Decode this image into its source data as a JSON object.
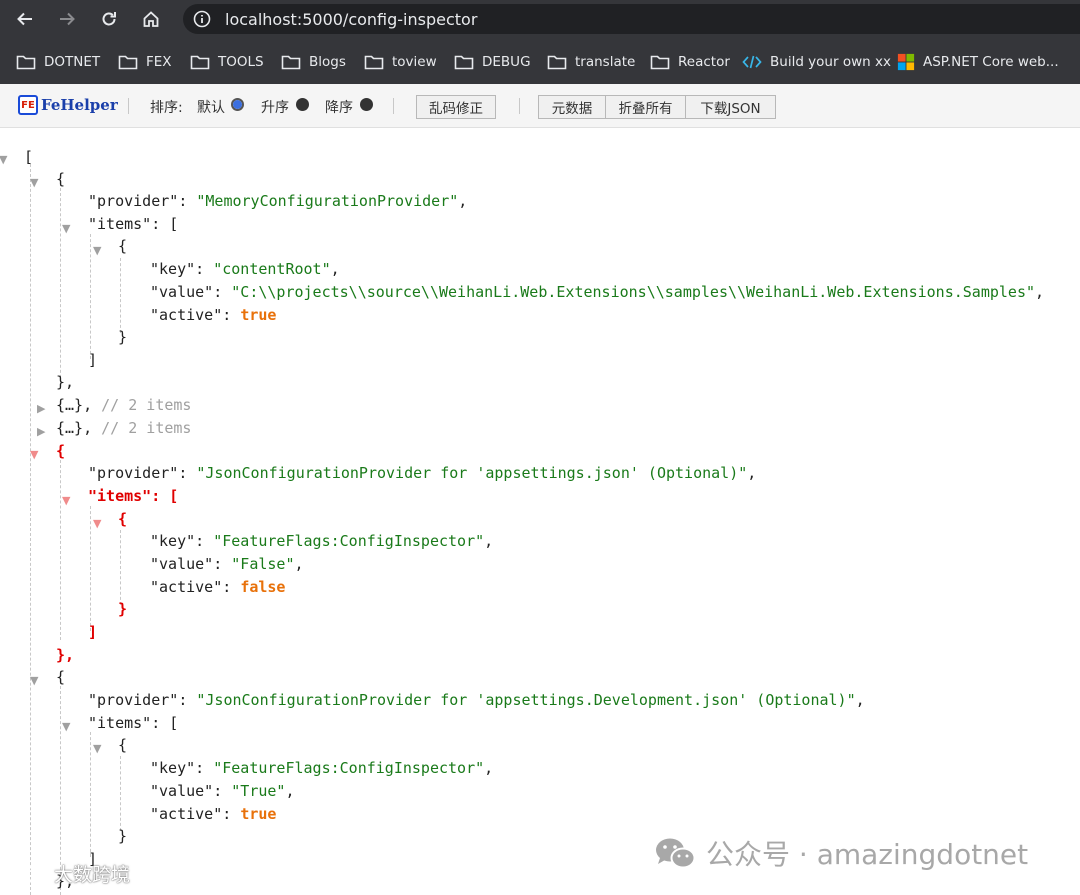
{
  "browser": {
    "url": "localhost:5000/config-inspector",
    "bookmarks": [
      {
        "label": "DOTNET",
        "icon": "folder-icon"
      },
      {
        "label": "FEX",
        "icon": "folder-icon"
      },
      {
        "label": "TOOLS",
        "icon": "folder-icon"
      },
      {
        "label": "Blogs",
        "icon": "folder-icon"
      },
      {
        "label": "toview",
        "icon": "folder-icon"
      },
      {
        "label": "DEBUG",
        "icon": "folder-icon"
      },
      {
        "label": "translate",
        "icon": "folder-icon"
      },
      {
        "label": "Reactor",
        "icon": "folder-icon"
      },
      {
        "label": "Build your own xx",
        "icon": "code-icon"
      },
      {
        "label": "ASP.NET Core web...",
        "icon": "microsoft-icon"
      }
    ]
  },
  "fehelper": {
    "name": "FeHelper",
    "badge": "FE",
    "sort_label": "排序:",
    "sort_options": [
      {
        "label": "默认",
        "selected": true
      },
      {
        "label": "升序",
        "selected": false
      },
      {
        "label": "降序",
        "selected": false
      }
    ],
    "buttons": {
      "fix_encoding": "乱码修正",
      "metadata": "元数据",
      "collapse_all": "折叠所有",
      "download_json": "下载JSON"
    }
  },
  "json_view": {
    "open_bracket": "[",
    "close_bracket": "]",
    "open_brace": "{",
    "close_brace": "}",
    "close_brace_comma": "},",
    "key_provider": "\"provider\"",
    "key_items": "\"items\"",
    "key_key": "\"key\"",
    "key_value": "\"value\"",
    "key_active": "\"active\"",
    "collapsed_object": "{…},",
    "collapsed_comment": "// 2 items",
    "entries": [
      {
        "provider": "\"MemoryConfigurationProvider\"",
        "key": "\"contentRoot\"",
        "value": "\"C:\\\\projects\\\\source\\\\WeihanLi.Web.Extensions\\\\samples\\\\WeihanLi.Web.Extensions.Samples\"",
        "active": "true"
      },
      {
        "provider": "\"JsonConfigurationProvider for 'appsettings.json' (Optional)\"",
        "key": "\"FeatureFlags:ConfigInspector\"",
        "value": "\"False\"",
        "active": "false"
      },
      {
        "provider": "\"JsonConfigurationProvider for 'appsettings.Development.json' (Optional)\"",
        "key": "\"FeatureFlags:ConfigInspector\"",
        "value": "\"True\"",
        "active": "true"
      }
    ]
  },
  "watermarks": {
    "right": "公众号 · amazingdotnet",
    "left": "大数跨境"
  }
}
